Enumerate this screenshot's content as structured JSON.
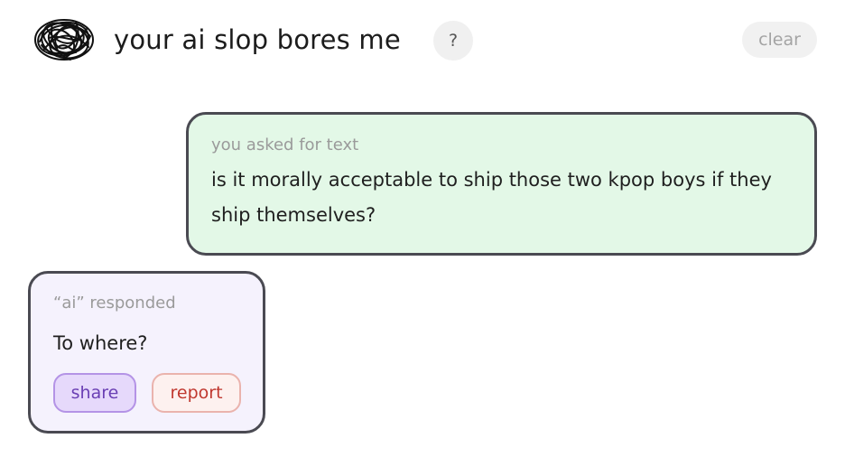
{
  "header": {
    "logo_icon": "scribble-ball-icon",
    "title": "your ai slop bores me",
    "help_label": "?",
    "clear_label": "clear"
  },
  "messages": {
    "user": {
      "label": "you asked for text",
      "text": "is it morally acceptable to ship those two kpop boys if they ship themselves?"
    },
    "ai": {
      "label": "“ai” responded",
      "text": "To where?",
      "share_label": "share",
      "report_label": "report"
    }
  },
  "colors": {
    "user_bubble_bg": "#e3f8e7",
    "ai_bubble_bg": "#f5f2fd",
    "bubble_border": "#4a4a52",
    "share_accent": "#6a3fb4",
    "report_accent": "#c0382f"
  }
}
